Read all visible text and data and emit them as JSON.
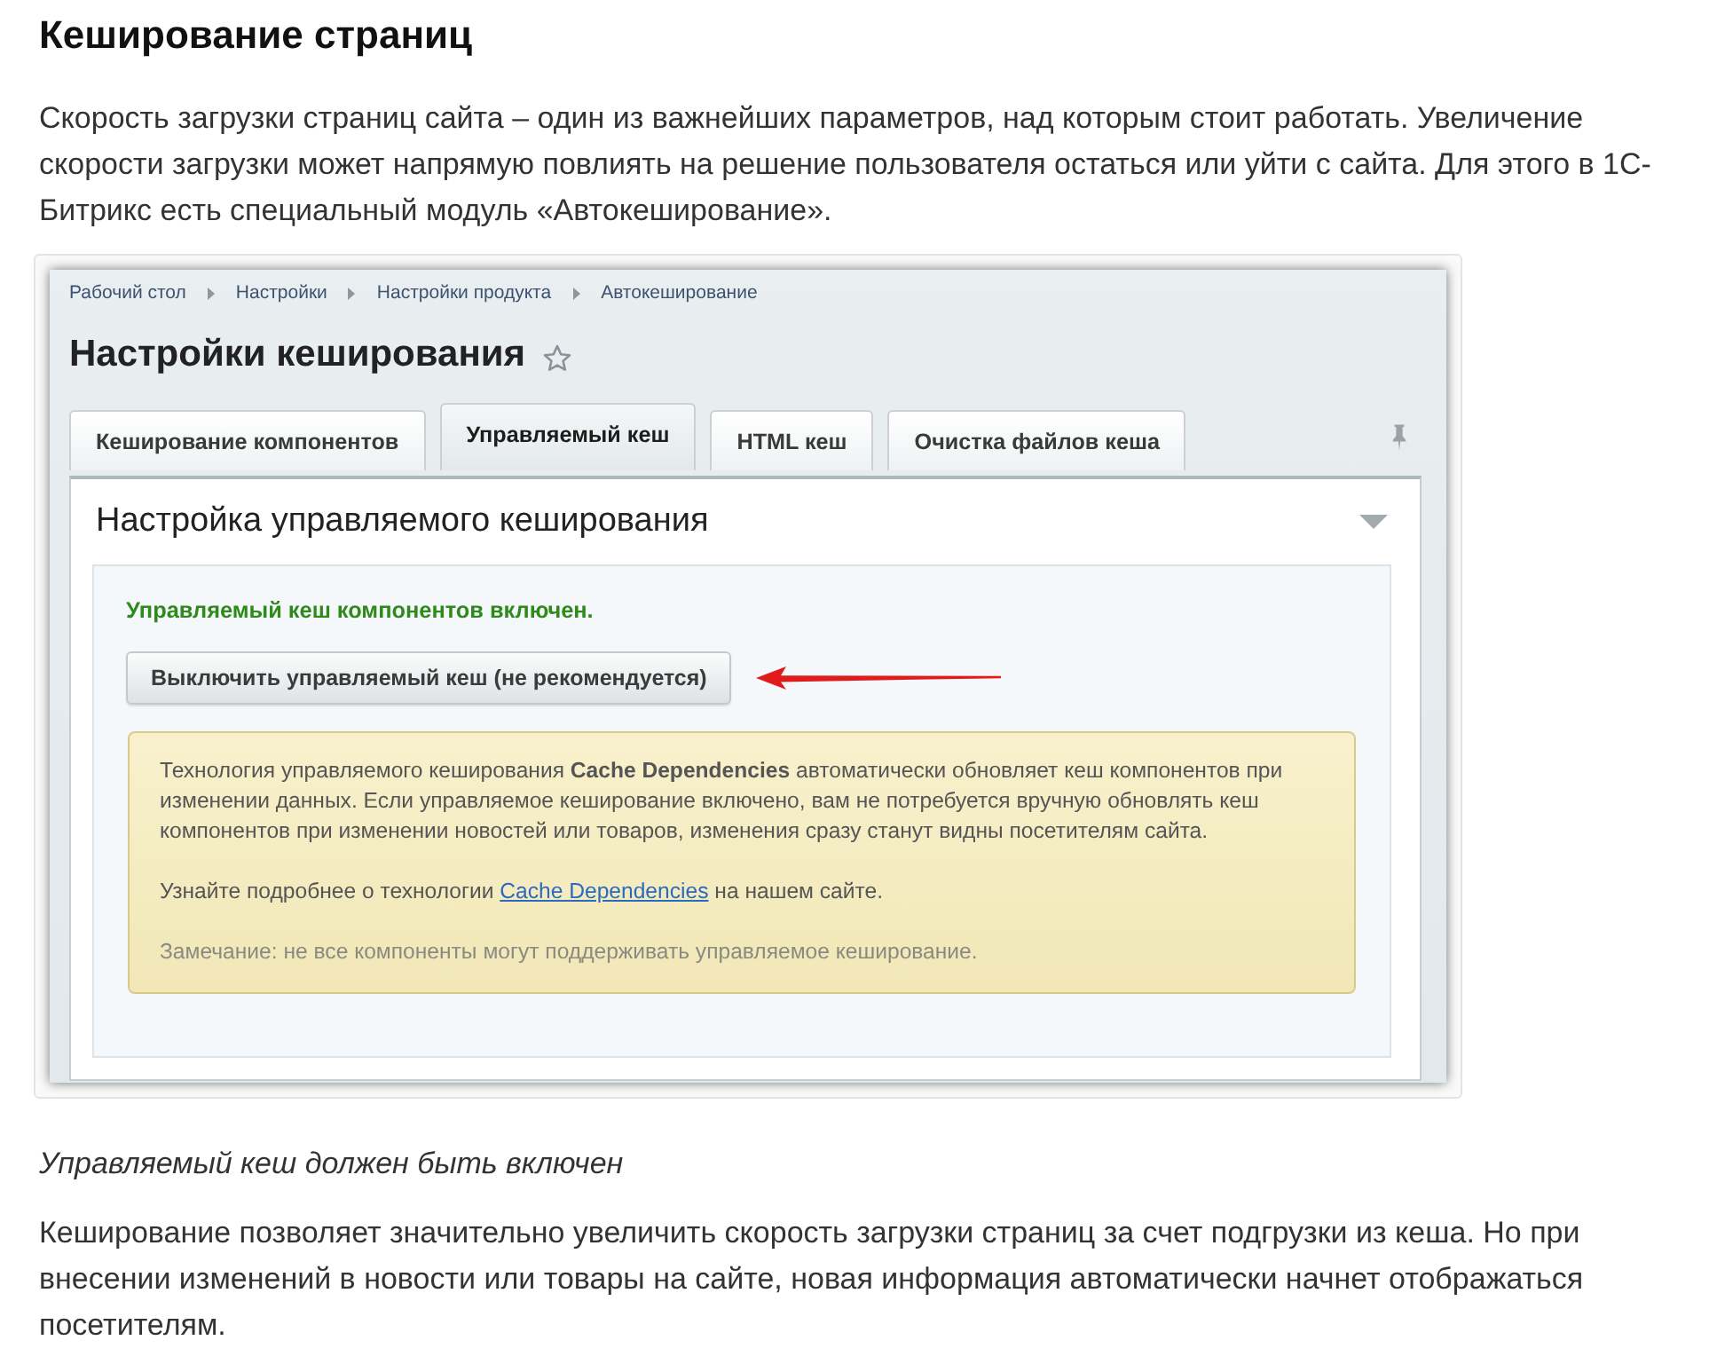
{
  "article": {
    "heading": "Кеширование страниц",
    "intro": "Скорость загрузки страниц сайта – один из важнейших параметров, над которым стоит работать. Увеличение скорости загрузки может напрямую повлиять на решение пользователя остаться или уйти с сайта. Для этого в 1С-Битрикс есть специальный модуль «Автокеширование»."
  },
  "screenshot": {
    "breadcrumbs": [
      "Рабочий стол",
      "Настройки",
      "Настройки продукта",
      "Автокеширование"
    ],
    "title": "Настройки кеширования",
    "favorite": false,
    "tabs": [
      {
        "label": "Кеширование компонентов",
        "selected": false
      },
      {
        "label": "Управляемый кеш",
        "selected": true
      },
      {
        "label": "HTML кеш",
        "selected": false
      },
      {
        "label": "Очистка файлов кеша",
        "selected": false
      }
    ],
    "panel": {
      "title": "Настройка управляемого кеширования",
      "status": "Управляемый кеш компонентов включен.",
      "button": "Выключить управляемый кеш (не рекомендуется)",
      "note": [
        {
          "kind": "text",
          "text": "Технология управляемого кеширования **Cache Dependencies** автоматически обновляет кеш компонентов при изменении данных. Если управляемое кеширование включено, вам не потребуется вручную обновлять кеш компонентов при изменении новостей или товаров, изменения сразу станут видны посетителям сайта."
        },
        {
          "kind": "link",
          "before": "Узнайте подробнее о технологии",
          "link": "Cache Dependencies",
          "after": "на нашем сайте."
        },
        {
          "kind": "remark",
          "text": "Замечание: не все компоненты могут поддерживать управляемое кеширование."
        }
      ]
    }
  },
  "caption": "Управляемый кеш должен быть включен",
  "body": "Кеширование позволяет значительно увеличить скорость загрузки страниц за счет подгрузки из кеша. Но при внесении изменений в новости или товары на сайте, новая информация автоматически начнет отображаться посетителям."
}
